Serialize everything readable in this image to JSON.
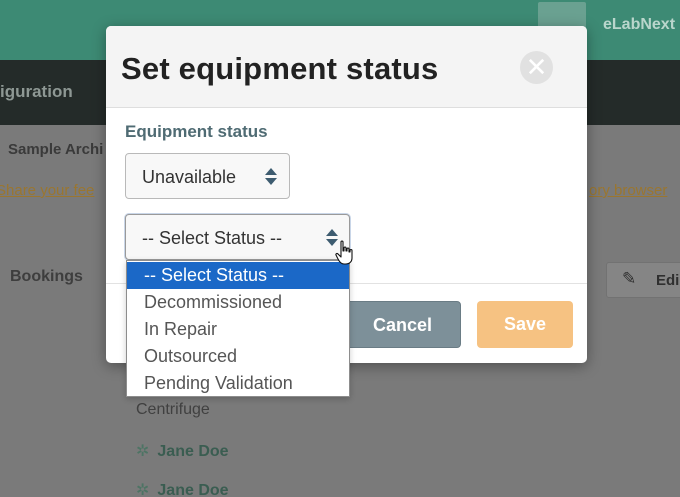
{
  "app": {
    "brand": "eLabNext"
  },
  "nav": {
    "configuration": "iguration"
  },
  "page": {
    "archive_title": "Sample Archi",
    "feedback_left": "Share your fee",
    "feedback_right": "ory browser",
    "tab_bookings": "Bookings",
    "edit_label": "Edi",
    "equipment_name": "Centrifuge",
    "users": [
      "Jane Doe",
      "Jane Doe"
    ]
  },
  "modal": {
    "title": "Set equipment status",
    "close_glyph": "✕",
    "field_label": "Equipment status",
    "status_select": {
      "value": "Unavailable"
    },
    "sub_status_select": {
      "value": "-- Select Status --",
      "options": [
        "-- Select Status --",
        "Decommissioned",
        "In Repair",
        "Outsourced",
        "Pending Validation"
      ],
      "selected_index": 0
    },
    "cancel_label": "Cancel",
    "save_label": "Save"
  },
  "colors": {
    "topbar": "#3d8a74",
    "navbar": "#242b29",
    "selected_option": "#1b68c7",
    "cancel_button": "#7d9099",
    "save_button": "#f6c282"
  },
  "icons": {
    "close": "close-icon",
    "select_arrows": "select-arrows-icon",
    "edit": "pencil-icon",
    "user": "cog-icon",
    "cursor": "hand-pointer-icon"
  }
}
